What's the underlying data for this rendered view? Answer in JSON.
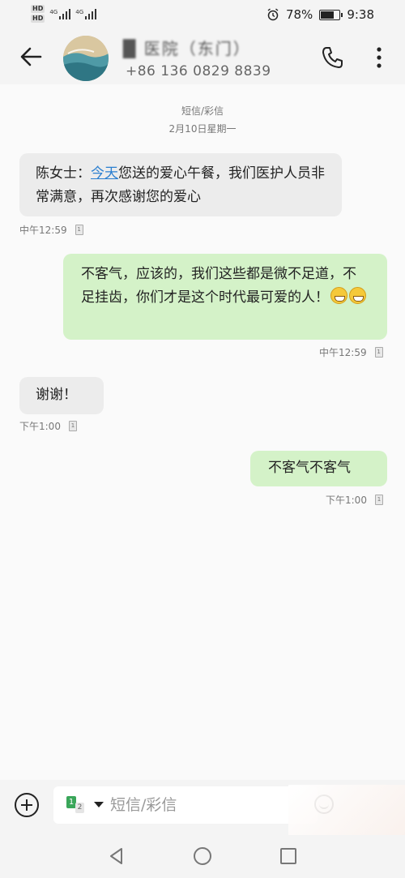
{
  "status_bar": {
    "hd1": "HD",
    "hd2": "HD",
    "net1": "4G",
    "net2": "4G",
    "battery_percent": "78%",
    "battery_level": 0.78,
    "time": "9:38",
    "icons": [
      "alarm-icon",
      "battery-icon",
      "signal-icon"
    ]
  },
  "header": {
    "contact_name": "█ 医院（东门）",
    "contact_number": "+86 136 0829 8839",
    "icons": [
      "back-arrow-icon",
      "phone-icon",
      "more-vert-icon"
    ]
  },
  "conversation": {
    "channel": "短信/彩信",
    "date": "2月10日星期一",
    "messages": [
      {
        "direction": "incoming",
        "parts": [
          "陈女士：",
          "今天",
          "您送的爱心午餐，我们医护人员非常满意，再次感谢您的爱心"
        ],
        "time": "中午12:59"
      },
      {
        "direction": "outgoing",
        "text": "不客气，应该的，我们这些都是微不足道，不足挂齿，你们才是这个时代最可爱的人！",
        "emoji": [
          "grin-emoji",
          "grin-emoji"
        ],
        "time": "中午12:59"
      },
      {
        "direction": "incoming",
        "text": "谢谢！",
        "time": "下午1:00"
      },
      {
        "direction": "outgoing",
        "text": "不客气不客气",
        "time": "下午1:00"
      }
    ]
  },
  "composer": {
    "sim_primary": "1",
    "sim_secondary": "2",
    "placeholder": "短信/彩信",
    "value": "",
    "icons": [
      "add-circle-icon",
      "sim-card-icon",
      "emoji-icon"
    ]
  },
  "nav_bar": {
    "icons": [
      "nav-back-icon",
      "nav-home-icon",
      "nav-recent-icon"
    ]
  },
  "colors": {
    "incoming_bubble": "#ececec",
    "outgoing_bubble": "#d4f2c8",
    "link": "#2b7fd0",
    "background": "#fafafa"
  }
}
